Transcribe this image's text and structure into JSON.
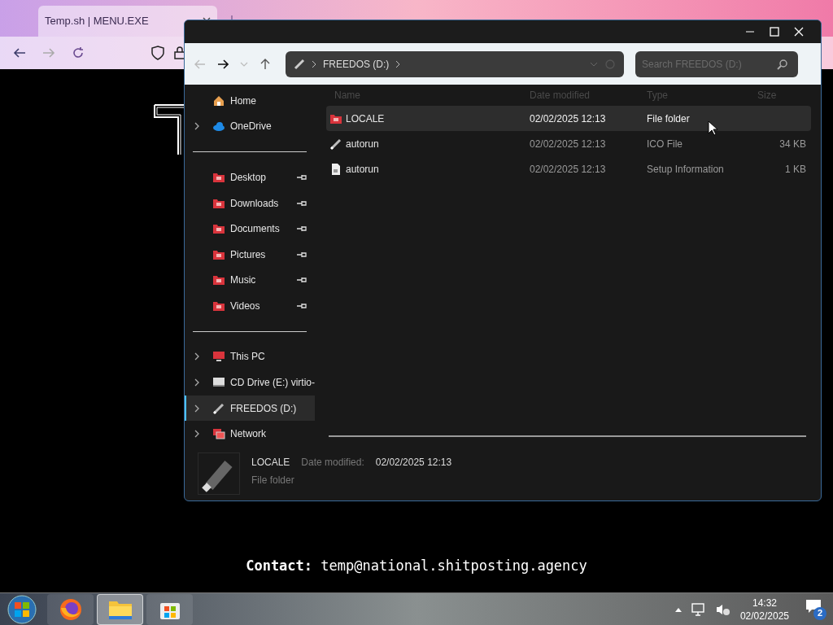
{
  "browser": {
    "tab": {
      "title": "Temp.sh | MENU.EXE",
      "selected": true
    },
    "page": {
      "contact": "**Contact:** temp@national.shitposting.agency"
    }
  },
  "explorer": {
    "toolbar": {
      "breadcrumb": "FREEDOS (D:)",
      "search": {
        "placeholder": "Search FREEDOS (D:)"
      }
    },
    "sidebar": {
      "items": [
        {
          "label": "Home",
          "kind": "home",
          "expandable": false,
          "pinned": false,
          "selected": false
        },
        {
          "label": "OneDrive",
          "kind": "cloud",
          "expandable": true,
          "pinned": false,
          "selected": false
        },
        {
          "kind": "divider"
        },
        {
          "label": "Desktop",
          "kind": "folder",
          "expandable": false,
          "pinned": true,
          "selected": false
        },
        {
          "label": "Downloads",
          "kind": "folder",
          "expandable": false,
          "pinned": true,
          "selected": false
        },
        {
          "label": "Documents",
          "kind": "folder",
          "expandable": false,
          "pinned": true,
          "selected": false
        },
        {
          "label": "Pictures",
          "kind": "folder",
          "expandable": false,
          "pinned": true,
          "selected": false
        },
        {
          "label": "Music",
          "kind": "folder",
          "expandable": false,
          "pinned": true,
          "selected": false
        },
        {
          "label": "Videos",
          "kind": "folder",
          "expandable": false,
          "pinned": true,
          "selected": false
        },
        {
          "kind": "divider"
        },
        {
          "label": "This PC",
          "kind": "pc",
          "expandable": true,
          "pinned": false,
          "selected": false
        },
        {
          "label": "CD Drive (E:) virtio-",
          "kind": "cd",
          "expandable": true,
          "pinned": false,
          "selected": false
        },
        {
          "label": "FREEDOS (D:)",
          "kind": "usb",
          "expandable": true,
          "pinned": false,
          "selected": true
        },
        {
          "label": "Network",
          "kind": "network",
          "expandable": true,
          "pinned": false,
          "selected": false
        }
      ]
    },
    "table": {
      "columns": [
        "Name",
        "Date modified",
        "Type",
        "Size"
      ],
      "rows": [
        {
          "name": "LOCALE",
          "kind": "folder",
          "date": "02/02/2025 12:13",
          "type": "File folder",
          "selected": true
        },
        {
          "name": "autorun",
          "kind": "usb",
          "date": "02/02/2025 12:13",
          "type": "ICO File",
          "size": "34 KB",
          "selected": false
        },
        {
          "name": "autorun",
          "kind": "document",
          "date": "02/02/2025 12:13",
          "type": "Setup Information",
          "size": "1 KB",
          "selected": false
        }
      ]
    },
    "details": {
      "name": "LOCALE",
      "date_label": "Date modified:",
      "date": "02/02/2025 12:13",
      "type": "File folder"
    }
  },
  "taskbar": {
    "apps": [
      {
        "kind": "firefox",
        "selected": false
      },
      {
        "kind": "explorer",
        "selected": true
      },
      {
        "kind": "store",
        "selected": false
      }
    ],
    "time": "14:32",
    "date": "02/02/2025",
    "notifications": "2"
  }
}
